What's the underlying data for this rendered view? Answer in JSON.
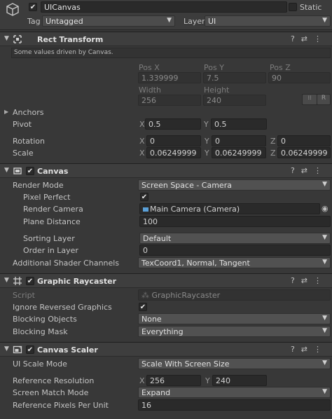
{
  "header": {
    "object_name": "UICanvas",
    "static_label": "Static",
    "tag_label": "Tag",
    "tag_value": "Untagged",
    "layer_label": "Layer",
    "layer_value": "UI"
  },
  "rect_transform": {
    "title": "Rect Transform",
    "info": "Some values driven by Canvas.",
    "pos_x_label": "Pos X",
    "pos_y_label": "Pos Y",
    "pos_z_label": "Pos Z",
    "pos_x": "1.339999",
    "pos_y": "7.5",
    "pos_z": "90",
    "width_label": "Width",
    "height_label": "Height",
    "width": "256",
    "height": "240",
    "anchors_label": "Anchors",
    "pivot_label": "Pivot",
    "pivot_x": "0.5",
    "pivot_y": "0.5",
    "rotation_label": "Rotation",
    "rot_x": "0",
    "rot_y": "0",
    "rot_z": "0",
    "scale_label": "Scale",
    "scale_x": "0.06249999",
    "scale_y": "0.06249999",
    "scale_z": "0.06249999",
    "axis_x": "X",
    "axis_y": "Y",
    "axis_z": "Z"
  },
  "canvas": {
    "title": "Canvas",
    "render_mode_label": "Render Mode",
    "render_mode": "Screen Space - Camera",
    "pixel_perfect_label": "Pixel Perfect",
    "render_camera_label": "Render Camera",
    "render_camera": "Main Camera (Camera)",
    "plane_distance_label": "Plane Distance",
    "plane_distance": "100",
    "sorting_layer_label": "Sorting Layer",
    "sorting_layer": "Default",
    "order_in_layer_label": "Order in Layer",
    "order_in_layer": "0",
    "shader_channels_label": "Additional Shader Channels",
    "shader_channels": "TexCoord1, Normal, Tangent"
  },
  "graphic_raycaster": {
    "title": "Graphic Raycaster",
    "script_label": "Script",
    "script_value": "GraphicRaycaster",
    "ignore_reversed_label": "Ignore Reversed Graphics",
    "blocking_objects_label": "Blocking Objects",
    "blocking_objects": "None",
    "blocking_mask_label": "Blocking Mask",
    "blocking_mask": "Everything"
  },
  "canvas_scaler": {
    "title": "Canvas Scaler",
    "ui_scale_mode_label": "UI Scale Mode",
    "ui_scale_mode": "Scale With Screen Size",
    "ref_resolution_label": "Reference Resolution",
    "ref_x": "256",
    "ref_y": "240",
    "match_mode_label": "Screen Match Mode",
    "match_mode": "Expand",
    "ref_ppu_label": "Reference Pixels Per Unit",
    "ref_ppu": "16"
  },
  "icons": {
    "check": "✔",
    "help": "?",
    "settings": "⇄",
    "menu": "⋮",
    "fold": "▼",
    "fold_closed": "▶",
    "dropdown": "▼",
    "target": "◉",
    "anchor_toggle": "⁞⁞",
    "reset": "R"
  }
}
